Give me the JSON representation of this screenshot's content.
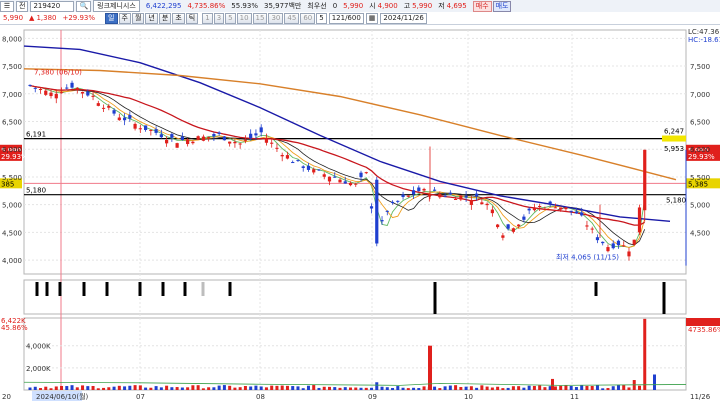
{
  "toolbar": {
    "menu_icon": "menu-icon",
    "period": "전",
    "code": "219420",
    "name": "링크제니시스",
    "price_label": "5,990",
    "change": "1,380",
    "change_pct": "+29.93%",
    "volume": "6,422,295",
    "turnover_pct": "4,735.86%",
    "strength": "55.93%",
    "amount": "35,977백만",
    "field_label": "최우선",
    "field_value": "0",
    "cur": "5,990",
    "open_label": "시",
    "open": "4,900",
    "high_label": "고",
    "high": "5,990",
    "low_label": "저",
    "low": "4,695",
    "buy_label": "매수",
    "sell_label": "매도"
  },
  "toolbar2": {
    "period_buttons": [
      "주",
      "월",
      "년",
      "분",
      "초",
      "틱"
    ],
    "min_buttons": [
      "1",
      "3",
      "5",
      "10",
      "15",
      "30",
      "45",
      "60"
    ],
    "count": "5",
    "page": "121/600",
    "date": "2024/11/26"
  },
  "chart_data": {
    "type": "candlestick",
    "y_ticks": [
      "8,000",
      "7,500",
      "7,000",
      "6,500",
      "6,000",
      "5,500",
      "5,000",
      "4,500",
      "4,000"
    ],
    "y_ticks_right": [
      "7,500",
      "7,000",
      "6,500",
      "6,000",
      "5,500",
      "5,000",
      "4,500"
    ],
    "y_range": [
      3750,
      8150
    ],
    "hlines": [
      {
        "label": "6,191",
        "value": 6191
      },
      {
        "label": "5,180",
        "value": 5180
      }
    ],
    "annotations": [
      {
        "text": "7,380 (06/10)",
        "value": 7380
      },
      {
        "text": "최저 4,065 (11/15)",
        "value": 4065
      },
      {
        "text": "6,247",
        "value": 6247
      },
      {
        "text": "5,953",
        "value": 5953
      },
      {
        "text": "5,180",
        "value": 5180
      }
    ],
    "right_labels": [
      {
        "text": "5,990",
        "value": 5990,
        "color": "#e0201c"
      },
      {
        "text": "29.93%",
        "value": 5880,
        "color": "#e0201c"
      },
      {
        "text": "5,385",
        "value": 5385,
        "color": "#e8d400"
      }
    ],
    "left_labels": [
      {
        "text": "5,990",
        "value": 5990,
        "color": "#e0201c"
      },
      {
        "text": "29.93%",
        "value": 5880,
        "color": "#e0201c"
      },
      {
        "text": "385",
        "value": 5385,
        "color": "#e8d400"
      }
    ],
    "legend_top_right": [
      "LC:47.36",
      "HC:-18.61"
    ],
    "x_labels": [
      "20",
      "2024/06/10(월)",
      "07",
      "08",
      "09",
      "10",
      "11",
      "11/26"
    ],
    "volume_ticks": [
      "4,000K",
      "2,000K"
    ],
    "volume_top_left": [
      "6,422K",
      "45.86%"
    ],
    "volume_top_right": [
      "6,422K",
      "4735.86%"
    ],
    "signal_series_count": 14
  }
}
